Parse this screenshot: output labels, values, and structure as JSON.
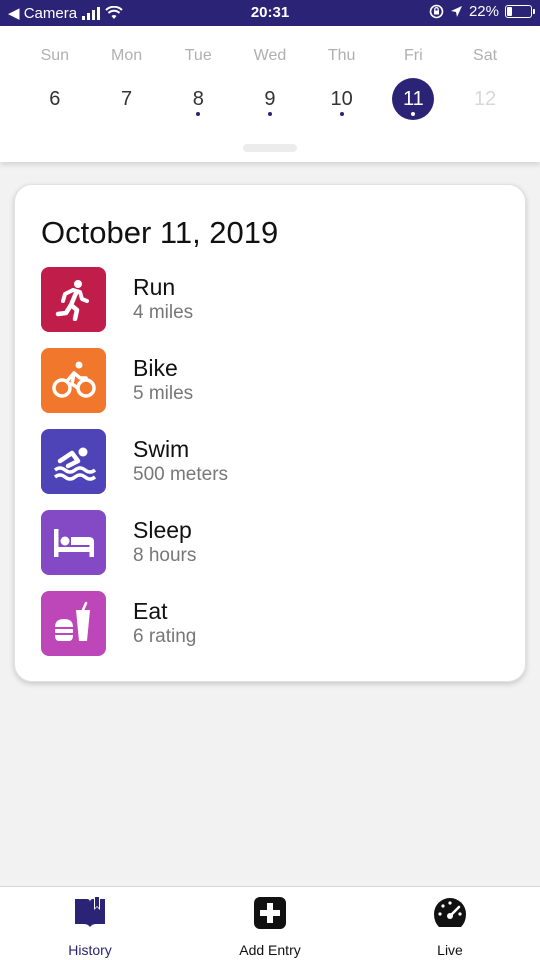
{
  "status_bar": {
    "back_label": "◀ Camera",
    "time": "20:31",
    "battery_text": "22%",
    "battery_level": 0.22
  },
  "week": {
    "days": [
      {
        "name": "Sun",
        "num": "6",
        "dot": false,
        "selected": false,
        "future": false
      },
      {
        "name": "Mon",
        "num": "7",
        "dot": false,
        "selected": false,
        "future": false
      },
      {
        "name": "Tue",
        "num": "8",
        "dot": true,
        "selected": false,
        "future": false
      },
      {
        "name": "Wed",
        "num": "9",
        "dot": true,
        "selected": false,
        "future": false
      },
      {
        "name": "Thu",
        "num": "10",
        "dot": true,
        "selected": false,
        "future": false
      },
      {
        "name": "Fri",
        "num": "11",
        "dot": true,
        "selected": true,
        "future": false
      },
      {
        "name": "Sat",
        "num": "12",
        "dot": false,
        "selected": false,
        "future": true
      }
    ]
  },
  "card": {
    "date_title": "October 11, 2019",
    "activities": [
      {
        "name": "Run",
        "value": "4 miles",
        "icon": "run-icon",
        "color": "#c11d4b"
      },
      {
        "name": "Bike",
        "value": "5 miles",
        "icon": "bike-icon",
        "color": "#f1772d"
      },
      {
        "name": "Swim",
        "value": "500 meters",
        "icon": "swim-icon",
        "color": "#4e44b8"
      },
      {
        "name": "Sleep",
        "value": "8 hours",
        "icon": "bed-icon",
        "color": "#8449c4"
      },
      {
        "name": "Eat",
        "value": "6 rating",
        "icon": "food-icon",
        "color": "#bd47b8"
      }
    ]
  },
  "tabs": [
    {
      "label": "History",
      "icon": "book-icon",
      "active": true
    },
    {
      "label": "Add Entry",
      "icon": "plus-square-icon",
      "active": false
    },
    {
      "label": "Live",
      "icon": "speedometer-icon",
      "active": false
    }
  ],
  "colors": {
    "primary": "#2b2476",
    "background": "#f2f2f2"
  }
}
